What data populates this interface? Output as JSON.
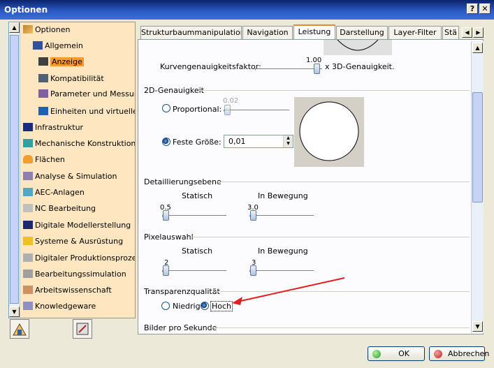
{
  "window": {
    "title": "Optionen",
    "help_label": "?",
    "close_label": "✕"
  },
  "tree": {
    "root_label": "Optionen",
    "items": [
      {
        "label": "Allgemein"
      },
      {
        "label": "Anzeige"
      },
      {
        "label": "Kompatibilität"
      },
      {
        "label": "Parameter und Messungen"
      },
      {
        "label": "Einheiten und virtuelle Re"
      },
      {
        "label": "Infrastruktur"
      },
      {
        "label": "Mechanische Konstruktion"
      },
      {
        "label": "Flächen"
      },
      {
        "label": "Analyse & Simulation"
      },
      {
        "label": "AEC-Anlagen"
      },
      {
        "label": "NC Bearbeitung"
      },
      {
        "label": "Digitale Modellerstellung"
      },
      {
        "label": "Systeme & Ausrüstung"
      },
      {
        "label": "Digitaler Produktionsprozess"
      },
      {
        "label": "Bearbeitungssimulation"
      },
      {
        "label": "Arbeitswissenschaft"
      },
      {
        "label": "Knowledgeware"
      }
    ]
  },
  "tabs": [
    {
      "label": "Strukturbaummanipulation"
    },
    {
      "label": "Navigation"
    },
    {
      "label": "Leistung"
    },
    {
      "label": "Darstellung"
    },
    {
      "label": "Layer-Filter"
    },
    {
      "label": "Stä"
    }
  ],
  "content": {
    "kurven_label": "Kurvengenauigkeitsfaktor:",
    "kurven_value": "1.00",
    "kurven_suffix": "x 3D-Genauigkeit.",
    "genauigkeit_2d_title": "2D-Genauigkeit",
    "proportional_label": "Proportional:",
    "proportional_value": "0.02",
    "feste_groesse_label": "Feste Größe:",
    "feste_groesse_value": "0,01",
    "detail_title": "Detaillierungsebene",
    "detail_static_label": "Statisch",
    "detail_static_value": "0.5",
    "detail_motion_label": "In Bewegung",
    "detail_motion_value": "3.0",
    "pixel_title": "Pixelauswahl",
    "pixel_static_label": "Statisch",
    "pixel_static_value": "2",
    "pixel_motion_label": "In Bewegung",
    "pixel_motion_value": "3",
    "transparenz_title": "Transparenzqualität",
    "niedrig_label": "Niedrig",
    "hoch_label": "Hoch",
    "bilder_title": "Bilder pro Sekunde"
  },
  "footer": {
    "ok_label": "OK",
    "cancel_label": "Abbrechen"
  },
  "colors": {
    "accent": "#e68b2c",
    "selected": "#ff9a2e",
    "arrow": "#e02020"
  }
}
